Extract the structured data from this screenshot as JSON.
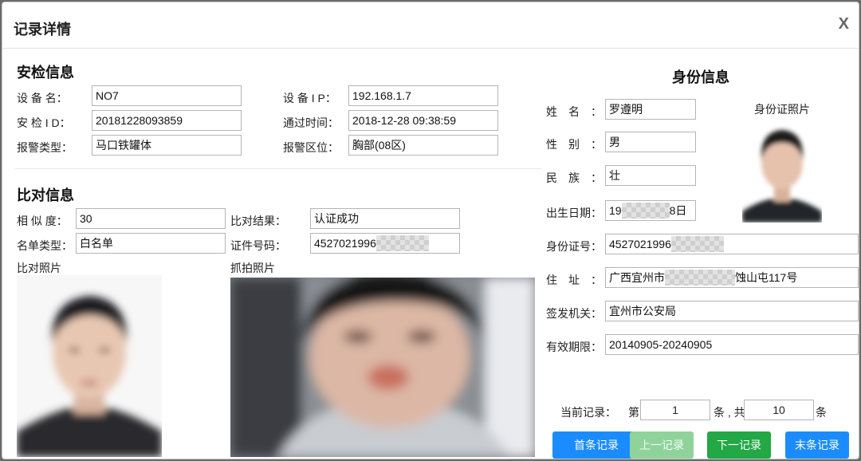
{
  "dialog": {
    "title": "记录详情",
    "close_label": "X"
  },
  "security": {
    "title": "安检信息",
    "device_name_label": "设 备 名：",
    "device_name": "NO7",
    "device_ip_label": "设 备 I P：",
    "device_ip": "192.168.1.7",
    "security_id_label": "安 检 I D：",
    "security_id": "20181228093859",
    "pass_time_label": "通过时间：",
    "pass_time": "2018-12-28 09:38:59",
    "alarm_type_label": "报警类型：",
    "alarm_type": "马口铁罐体",
    "alarm_area_label": "报警区位：",
    "alarm_area": "胸部(08区)"
  },
  "compare": {
    "title": "比对信息",
    "similarity_label": "相 似 度：",
    "similarity": "30",
    "result_label": "比对结果：",
    "result": "认证成功",
    "list_type_label": "名单类型：",
    "list_type": "白名单",
    "cert_no_label": "证件号码：",
    "cert_no_visible": "4527021996",
    "compare_photo_label": "比对照片",
    "capture_photo_label": "抓拍照片"
  },
  "identity": {
    "title": "身份信息",
    "id_photo_label": "身份证照片",
    "name_label": "姓　名　：",
    "name": "罗遵明",
    "gender_label": "性　别　：",
    "gender": "男",
    "ethnicity_label": "民　族　：",
    "ethnicity": "壮",
    "birth_label": "出生日期：",
    "birth_prefix": "19",
    "birth_suffix": "8日",
    "id_no_label": "身份证号：",
    "id_no_visible": "4527021996",
    "address_label": "住　址　：",
    "address_prefix": "广西宜州市",
    "address_suffix": "蚀山屯117号",
    "issuer_label": "签发机关：",
    "issuer": "宜州市公安局",
    "validity_label": "有效期限：",
    "validity": "20140905-20240905"
  },
  "pager": {
    "current_label": "当前记录：",
    "prefix": "第",
    "current": "1",
    "middle": "条 , 共",
    "total": "10",
    "suffix": "条",
    "first_label": "首条记录",
    "prev_label": "上一记录",
    "next_label": "下一记录",
    "last_label": "末条记录"
  },
  "colors": {
    "primary_button": "#1a8cff",
    "disabled_button": "#8fd39b",
    "success_button": "#22a845"
  }
}
